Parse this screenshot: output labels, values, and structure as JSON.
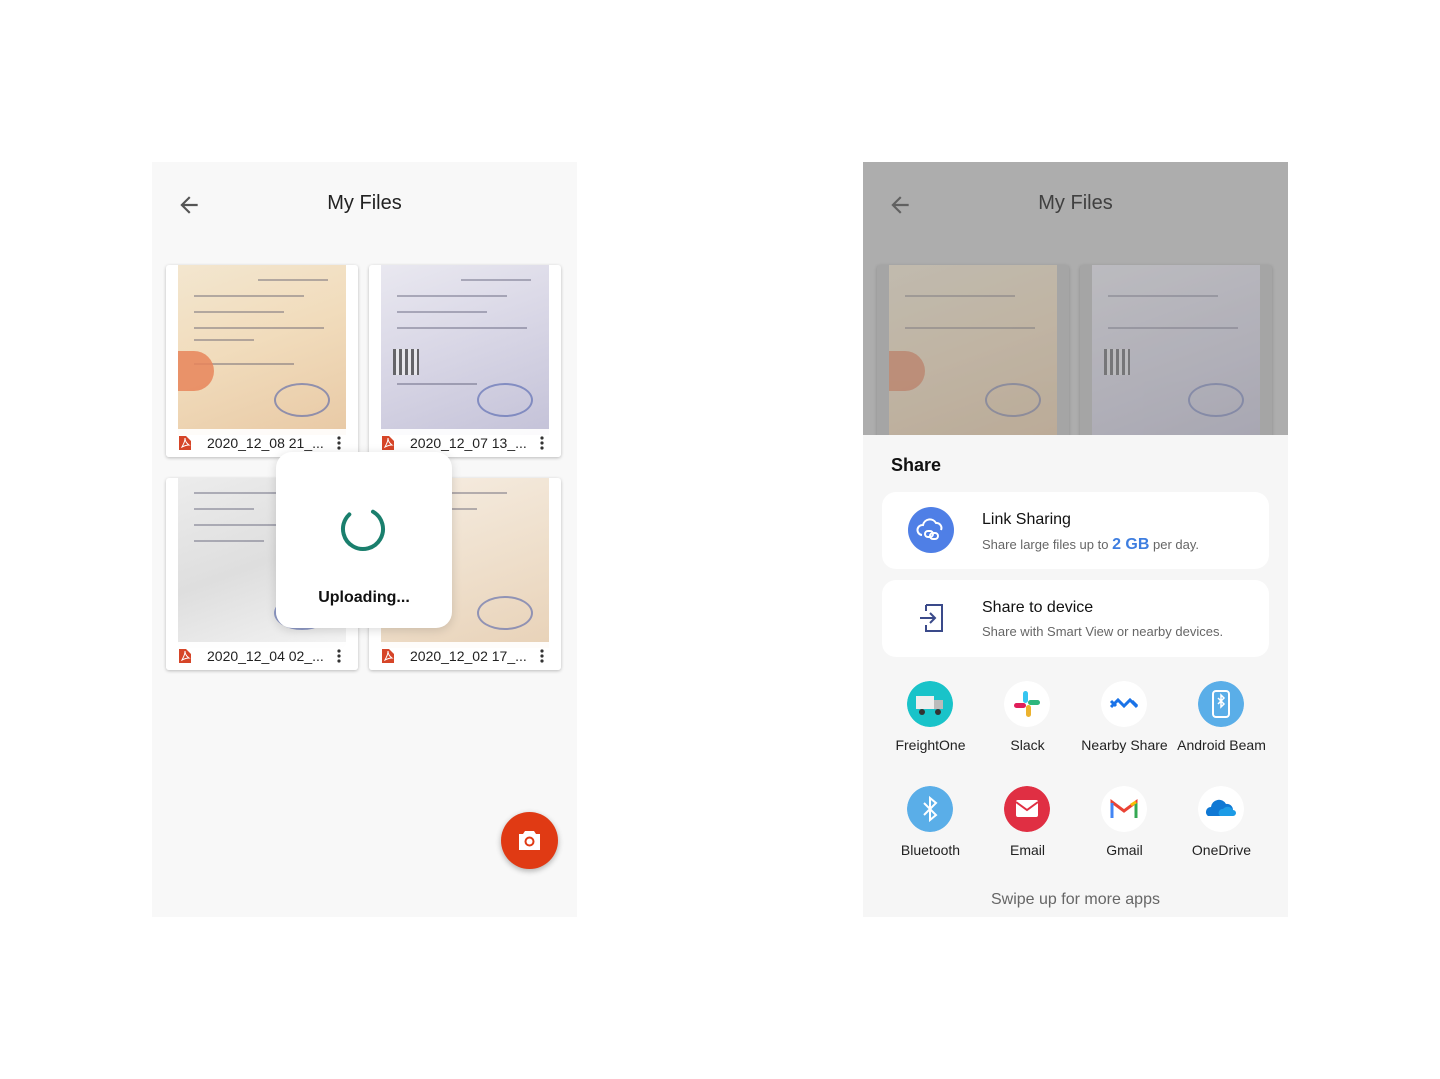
{
  "left_screen": {
    "title": "My Files",
    "files": [
      {
        "name": "2020_12_08 21_...",
        "thumb": "warm"
      },
      {
        "name": "2020_12_07 13_...",
        "thumb": "cool"
      },
      {
        "name": "2020_12_04 02_...",
        "thumb": "cool"
      },
      {
        "name": "2020_12_02 17_...",
        "thumb": "warm"
      }
    ],
    "dialog": {
      "text": "Uploading..."
    },
    "accent": "#e03a14",
    "spinner_color": "#1a7f6d"
  },
  "right_screen": {
    "title": "My Files",
    "share": {
      "title": "Share",
      "link_sharing": {
        "title": "Link Sharing",
        "desc_prefix": "Share large files up to ",
        "desc_amount": "2 GB",
        "desc_suffix": " per day."
      },
      "share_to_device": {
        "title": "Share to device",
        "desc": "Share with Smart View or nearby devices."
      },
      "apps": [
        {
          "label": "FreightOne",
          "icon": "truck-icon"
        },
        {
          "label": "Slack",
          "icon": "slack-icon"
        },
        {
          "label": "Nearby Share",
          "icon": "nearby-share-icon"
        },
        {
          "label": "Android Beam",
          "icon": "android-beam-icon"
        },
        {
          "label": "Bluetooth",
          "icon": "bluetooth-icon"
        },
        {
          "label": "Email",
          "icon": "email-icon"
        },
        {
          "label": "Gmail",
          "icon": "gmail-icon"
        },
        {
          "label": "OneDrive",
          "icon": "onedrive-icon"
        }
      ],
      "swipe_hint": "Swipe up for more apps"
    }
  }
}
